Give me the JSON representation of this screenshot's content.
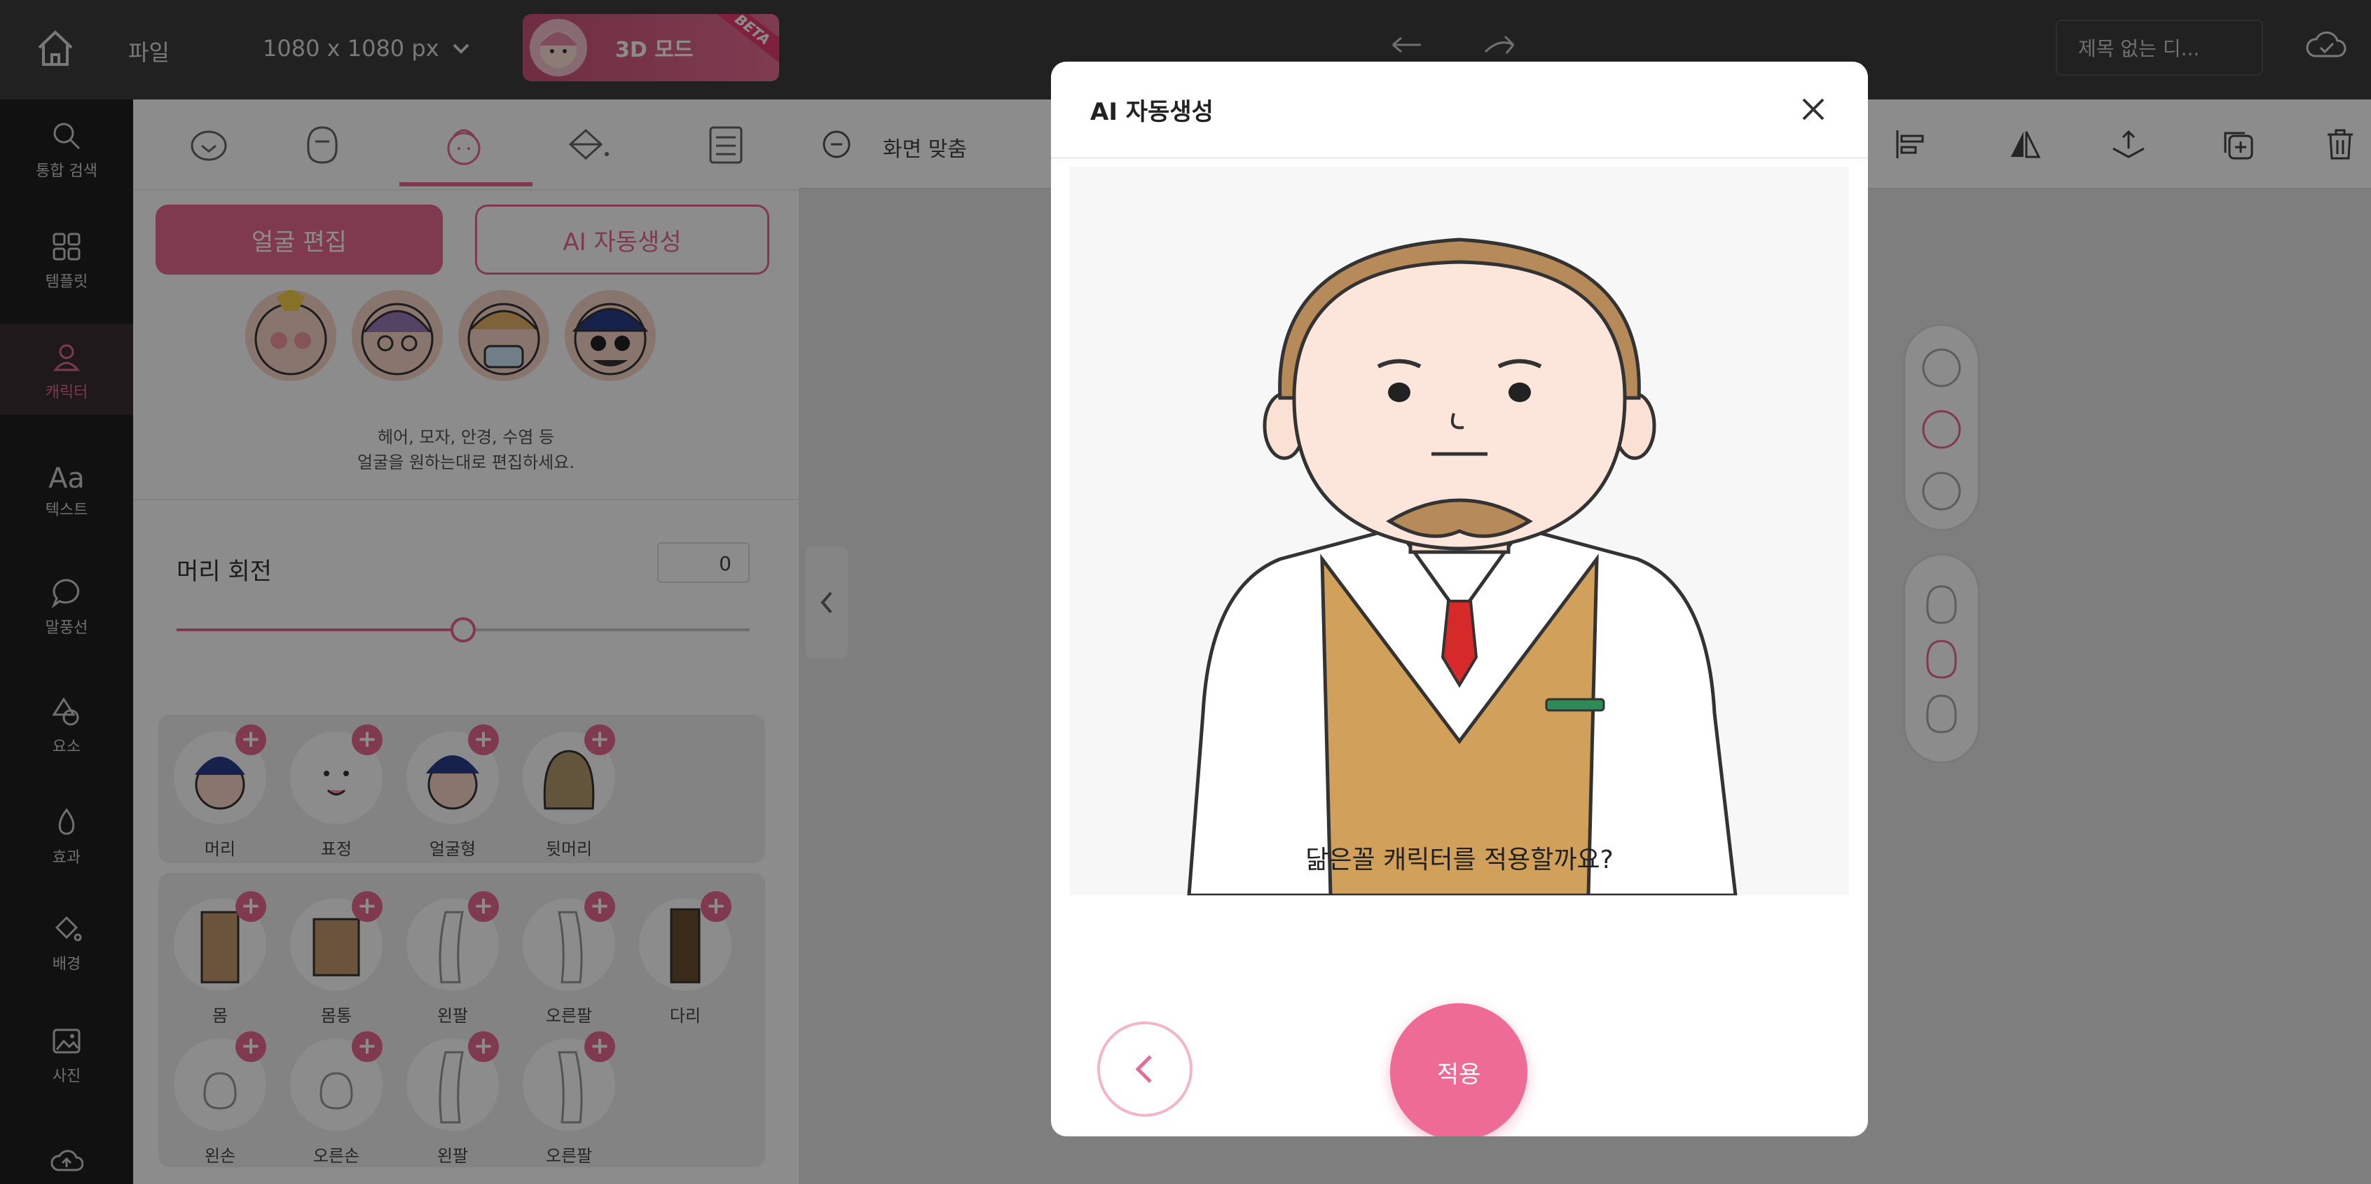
{
  "topbar": {
    "file_label": "파일",
    "canvas_size": "1080 x 1080 px",
    "mode_label": "3D 모드",
    "mode_badge": "BETA",
    "document_title": "제목 없는 디..."
  },
  "left_nav": {
    "items": [
      {
        "label": "통합 검색",
        "icon": "search-icon"
      },
      {
        "label": "템플릿",
        "icon": "grid-icon"
      },
      {
        "label": "캐릭터",
        "icon": "person-icon"
      },
      {
        "label": "텍스트",
        "icon": "text-icon"
      },
      {
        "label": "말풍선",
        "icon": "speech-bubble-icon"
      },
      {
        "label": "요소",
        "icon": "shapes-icon"
      },
      {
        "label": "효과",
        "icon": "effect-icon"
      },
      {
        "label": "배경",
        "icon": "paint-bucket-icon"
      },
      {
        "label": "사진",
        "icon": "photo-icon"
      }
    ]
  },
  "panel": {
    "tab_icons": [
      "face-outline-icon",
      "head-icon",
      "face-edit-icon",
      "bucket-icon",
      "outfit-icon"
    ],
    "face_edit_button": "얼굴 편집",
    "ai_generate_button": "AI 자동생성",
    "description_line1": "헤어, 모자, 안경, 수염 등",
    "description_line2": "얼굴을 원하는대로 편집하세요.",
    "head_rotation_label": "머리 회전",
    "head_rotation_value": "0",
    "head_rotation_slider": 0.5,
    "head_parts": [
      "머리",
      "표정",
      "얼굴형",
      "뒷머리"
    ],
    "body_parts": [
      "몸",
      "몸통",
      "왼팔",
      "오른팔",
      "다리"
    ],
    "hand_parts": [
      "왼손",
      "오른손",
      "왼팔",
      "오른팔"
    ]
  },
  "canvas_toolbar": {
    "fit_label": "화면 맞춤"
  },
  "modal": {
    "title": "AI 자동생성",
    "question": "닮은꼴 캐릭터를 적용할까요?",
    "apply_button": "적용"
  }
}
